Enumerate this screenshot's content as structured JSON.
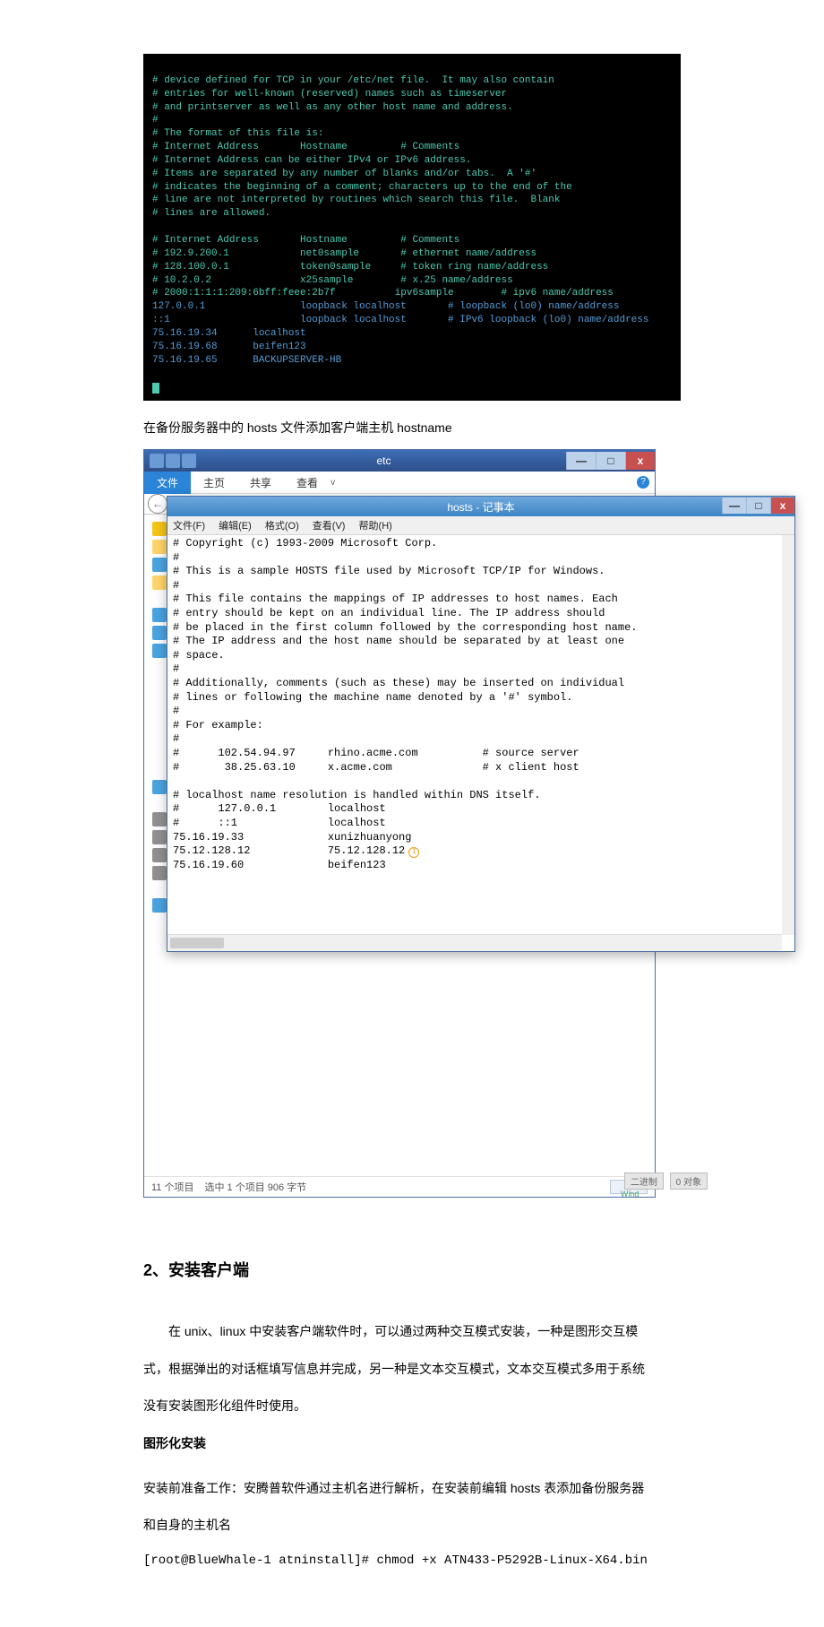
{
  "terminal": {
    "line1": "# device defined for TCP in your /etc/net file.  It may also contain",
    "line2": "# entries for well-known (reserved) names such as timeserver",
    "line3": "# and printserver as well as any other host name and address.",
    "line4": "#",
    "line5": "# The format of this file is:",
    "line6": "# Internet Address       Hostname         # Comments",
    "line7": "# Internet Address can be either IPv4 or IPv6 address.",
    "line8": "# Items are separated by any number of blanks and/or tabs.  A '#'",
    "line9": "# indicates the beginning of a comment; characters up to the end of the",
    "line10": "# line are not interpreted by routines which search this file.  Blank",
    "line11": "# lines are allowed.",
    "line12": "",
    "line13": "# Internet Address       Hostname         # Comments",
    "line14": "# 192.9.200.1            net0sample       # ethernet name/address",
    "line15": "# 128.100.0.1            token0sample     # token ring name/address",
    "line16": "# 10.2.0.2               x25sample        # x.25 name/address",
    "line17": "# 2000:1:1:1:209:6bff:feee:2b7f          ipv6sample        # ipv6 name/address",
    "line18": "127.0.0.1                loopback localhost       # loopback (lo0) name/address",
    "line19": "::1                      loopback localhost       # IPv6 loopback (lo0) name/address",
    "line20a": "75.16.19.34      localhost",
    "line20b": "75.16.19.68      beifen123",
    "line20c": "75.16.19.65      BACKUPSERVER-HB"
  },
  "caption1": "在备份服务器中的 hosts 文件添加客户端主机 hostname",
  "explorer": {
    "title": "etc",
    "win_min": "—",
    "win_max": "□",
    "win_close": "x",
    "file_tab": "文件",
    "tab_home": "主页",
    "tab_share": "共享",
    "tab_view": "查看",
    "help_v": "v",
    "help_q": "?"
  },
  "notepad": {
    "title": "hosts - 记事本",
    "menu_file": "文件(F)",
    "menu_edit": "编辑(E)",
    "menu_format": "格式(O)",
    "menu_view": "查看(V)",
    "menu_help": "帮助(H)",
    "l1": "# Copyright (c) 1993-2009 Microsoft Corp.",
    "l2": "#",
    "l3": "# This is a sample HOSTS file used by Microsoft TCP/IP for Windows.",
    "l4": "#",
    "l5": "# This file contains the mappings of IP addresses to host names. Each",
    "l6": "# entry should be kept on an individual line. The IP address should",
    "l7": "# be placed in the first column followed by the corresponding host name.",
    "l8": "# The IP address and the host name should be separated by at least one",
    "l9": "# space.",
    "l10": "#",
    "l11": "# Additionally, comments (such as these) may be inserted on individual",
    "l12": "# lines or following the machine name denoted by a '#' symbol.",
    "l13": "#",
    "l14": "# For example:",
    "l15": "#",
    "l16": "#      102.54.94.97     rhino.acme.com          # source server",
    "l17": "#       38.25.63.10     x.acme.com              # x client host",
    "l18": "",
    "l19": "# localhost name resolution is handled within DNS itself.",
    "l20": "#      127.0.0.1        localhost",
    "l21": "#      ::1              localhost",
    "l22": "75.16.19.33             xunizhuanyong",
    "l23": "75.12.128.12            75.12.128.12",
    "l24": "75.16.19.60             beifen123",
    "caret": "I"
  },
  "statusbar": {
    "count": "11 个项目",
    "selected": "选中 1 个项目  906 字节",
    "task1": "二进制",
    "task2": "0 对象",
    "task3": "Wind"
  },
  "doc": {
    "h2": "2、安装客户端",
    "p1": "在 unix、linux 中安装客户端软件时，可以通过两种交互模式安装，一种是图形交互模",
    "p2": "式，根据弹出的对话框填写信息并完成，另一种是文本交互模式，文本交互模式多用于系统",
    "p3": "没有安装图形化组件时使用。",
    "sub": "图形化安装",
    "p4": "安装前准备工作：安腾普软件通过主机名进行解析，在安装前编辑 hosts 表添加备份服务器",
    "p5": "和自身的主机名",
    "cmd": "[root@BlueWhale-1 atninstall]# chmod +x ATN433-P5292B-Linux-X64.bin"
  }
}
